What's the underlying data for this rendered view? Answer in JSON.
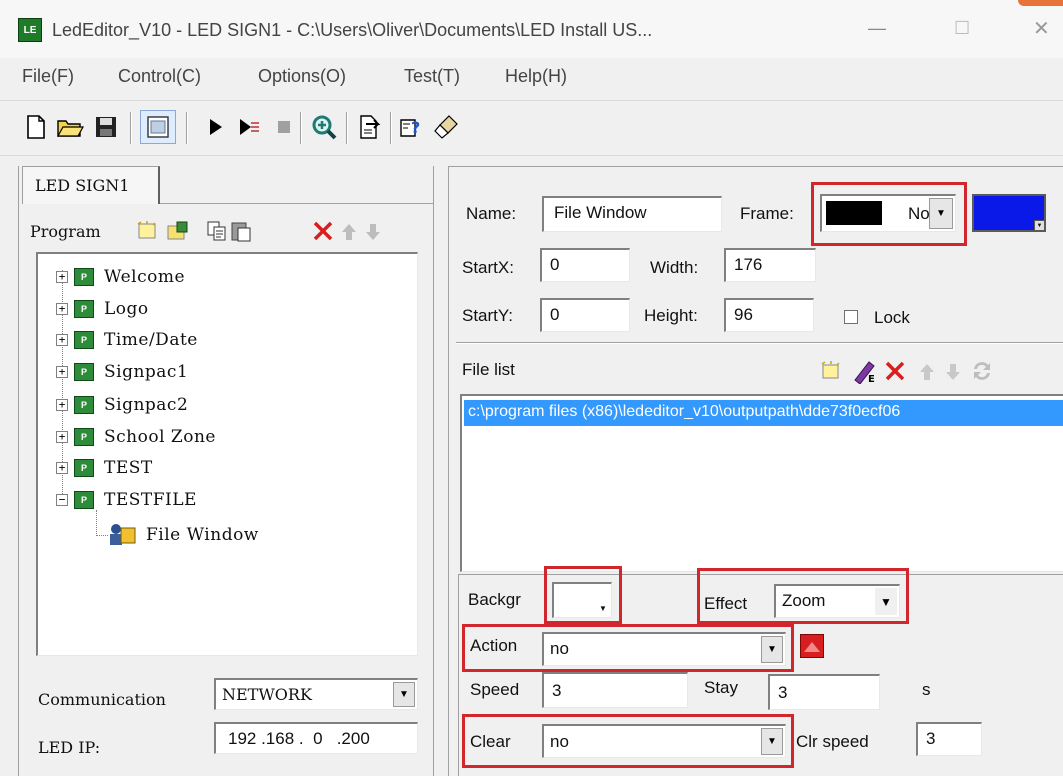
{
  "window": {
    "title": "LedEditor_V10 - LED SIGN1 - C:\\Users\\Oliver\\Documents\\LED Install US...",
    "minimize_glyph": "—",
    "maximize_glyph": "☐",
    "close_glyph": "✕",
    "app_icon_text": "LE"
  },
  "menu": [
    "File(F)",
    "Control(C)",
    "Options(O)",
    "Test(T)",
    "Help(H)"
  ],
  "toolbar": {
    "icons": [
      "new-file-icon",
      "open-folder-icon",
      "save-icon",
      "grid-view-icon",
      "play-icon",
      "step-play-icon",
      "stop-icon",
      "zoom-icon",
      "export-icon",
      "help-icon",
      "clean-brush-icon"
    ]
  },
  "left": {
    "tab_label": "LED SIGN1",
    "program_label": "Program",
    "tree": [
      {
        "expander": "+",
        "label": "Welcome"
      },
      {
        "expander": "+",
        "label": "Logo"
      },
      {
        "expander": "+",
        "label": "Time/Date"
      },
      {
        "expander": "+",
        "label": "Signpac1"
      },
      {
        "expander": "+",
        "label": "Signpac2"
      },
      {
        "expander": "+",
        "label": "School Zone"
      },
      {
        "expander": "+",
        "label": "TEST"
      },
      {
        "expander": "−",
        "label": "TESTFILE"
      }
    ],
    "child_label": "File Window",
    "communication_label": "Communication",
    "communication_value": "NETWORK",
    "ip_label": "LED IP:",
    "ip_value": "192 .168 .  0   .200"
  },
  "right": {
    "name_label": "Name:",
    "name_value": "File Window",
    "frame_label": "Frame:",
    "frame_value": "No",
    "startx_label": "StartX:",
    "startx_value": "0",
    "width_label": "Width:",
    "width_value": "176",
    "starty_label": "StartY:",
    "starty_value": "0",
    "height_label": "Height:",
    "height_value": "96",
    "lock_label": "Lock",
    "file_list_label": "File list",
    "file_list_item": "c:\\program files (x86)\\lededitor_v10\\outputpath\\dde73f0ecf06",
    "background_label": "Backgr",
    "effect_label": "Effect",
    "effect_value": "Zoom",
    "action_label": "Action",
    "action_value": "no",
    "speed_label": "Speed",
    "speed_value": "3",
    "stay_label": "Stay",
    "stay_value": "3",
    "stay_unit": "s",
    "clear_label": "Clear",
    "clear_value": "no",
    "clr_speed_label": "Clr speed",
    "clr_speed_value": "3"
  },
  "colors": {
    "frame_color": "#000000",
    "frame_color2": "#0000ff",
    "highlight_box": "#d0262c",
    "selection": "#3399ff"
  }
}
